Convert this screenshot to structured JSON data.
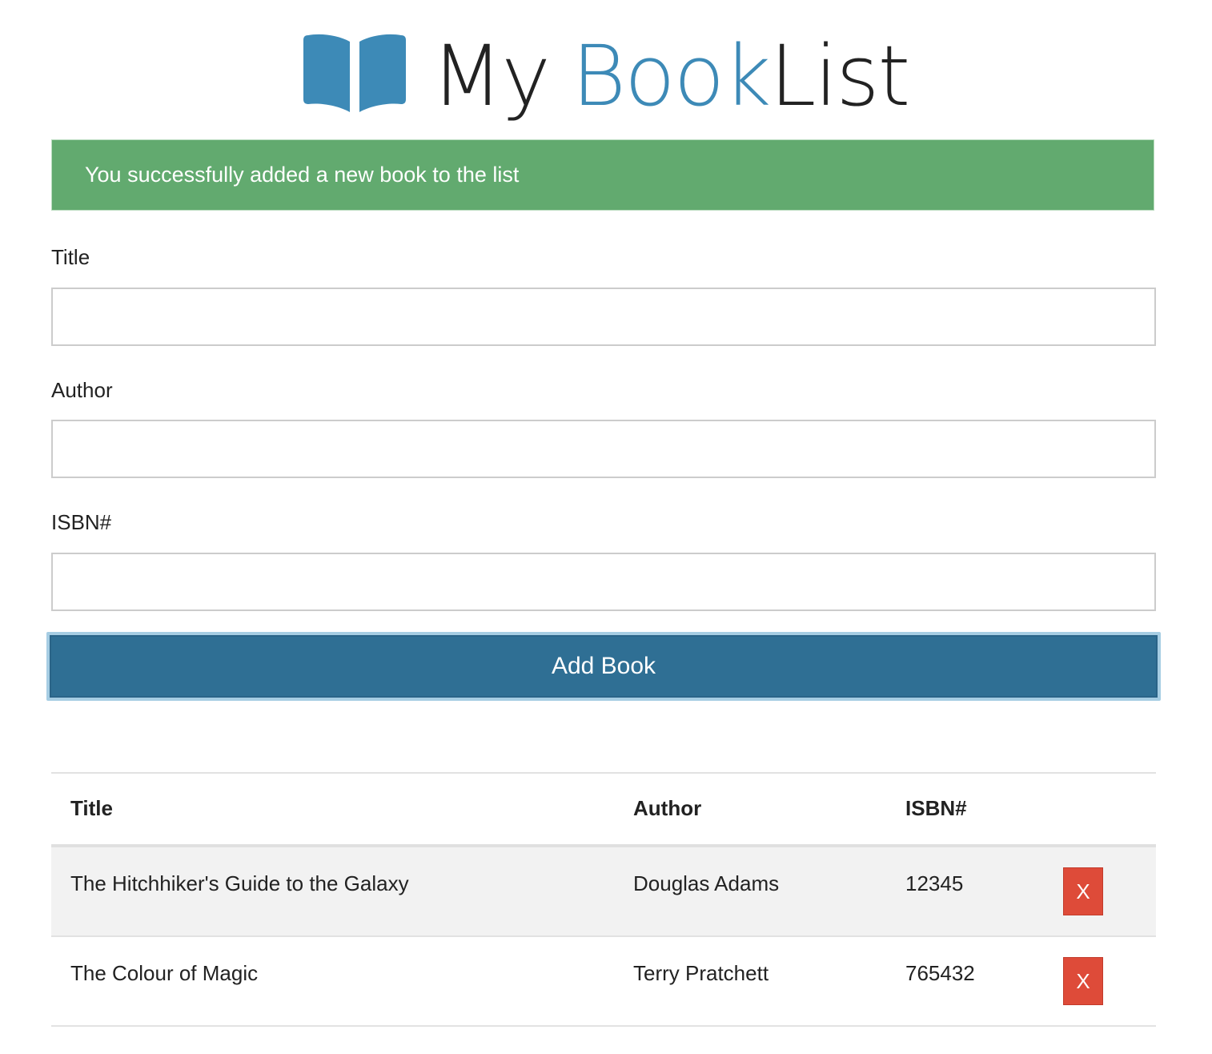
{
  "header": {
    "title_part1": "My",
    "title_part2": "Book",
    "title_part3": "List",
    "icon": "book-open-icon",
    "accent_color": "#3d8ab7"
  },
  "alert": {
    "message": "You successfully added a new book to the list",
    "color": "#62aa6f"
  },
  "form": {
    "title_label": "Title",
    "title_value": "",
    "author_label": "Author",
    "author_value": "",
    "isbn_label": "ISBN#",
    "isbn_value": "",
    "submit_label": "Add Book",
    "submit_color": "#2f6f94"
  },
  "table": {
    "columns": [
      "Title",
      "Author",
      "ISBN#"
    ],
    "rows": [
      {
        "title": "The Hitchhiker's Guide to the Galaxy",
        "author": "Douglas Adams",
        "isbn": "12345",
        "delete_label": "X"
      },
      {
        "title": "The Colour of Magic",
        "author": "Terry Pratchett",
        "isbn": "765432",
        "delete_label": "X"
      }
    ],
    "delete_color": "#de4b39"
  }
}
